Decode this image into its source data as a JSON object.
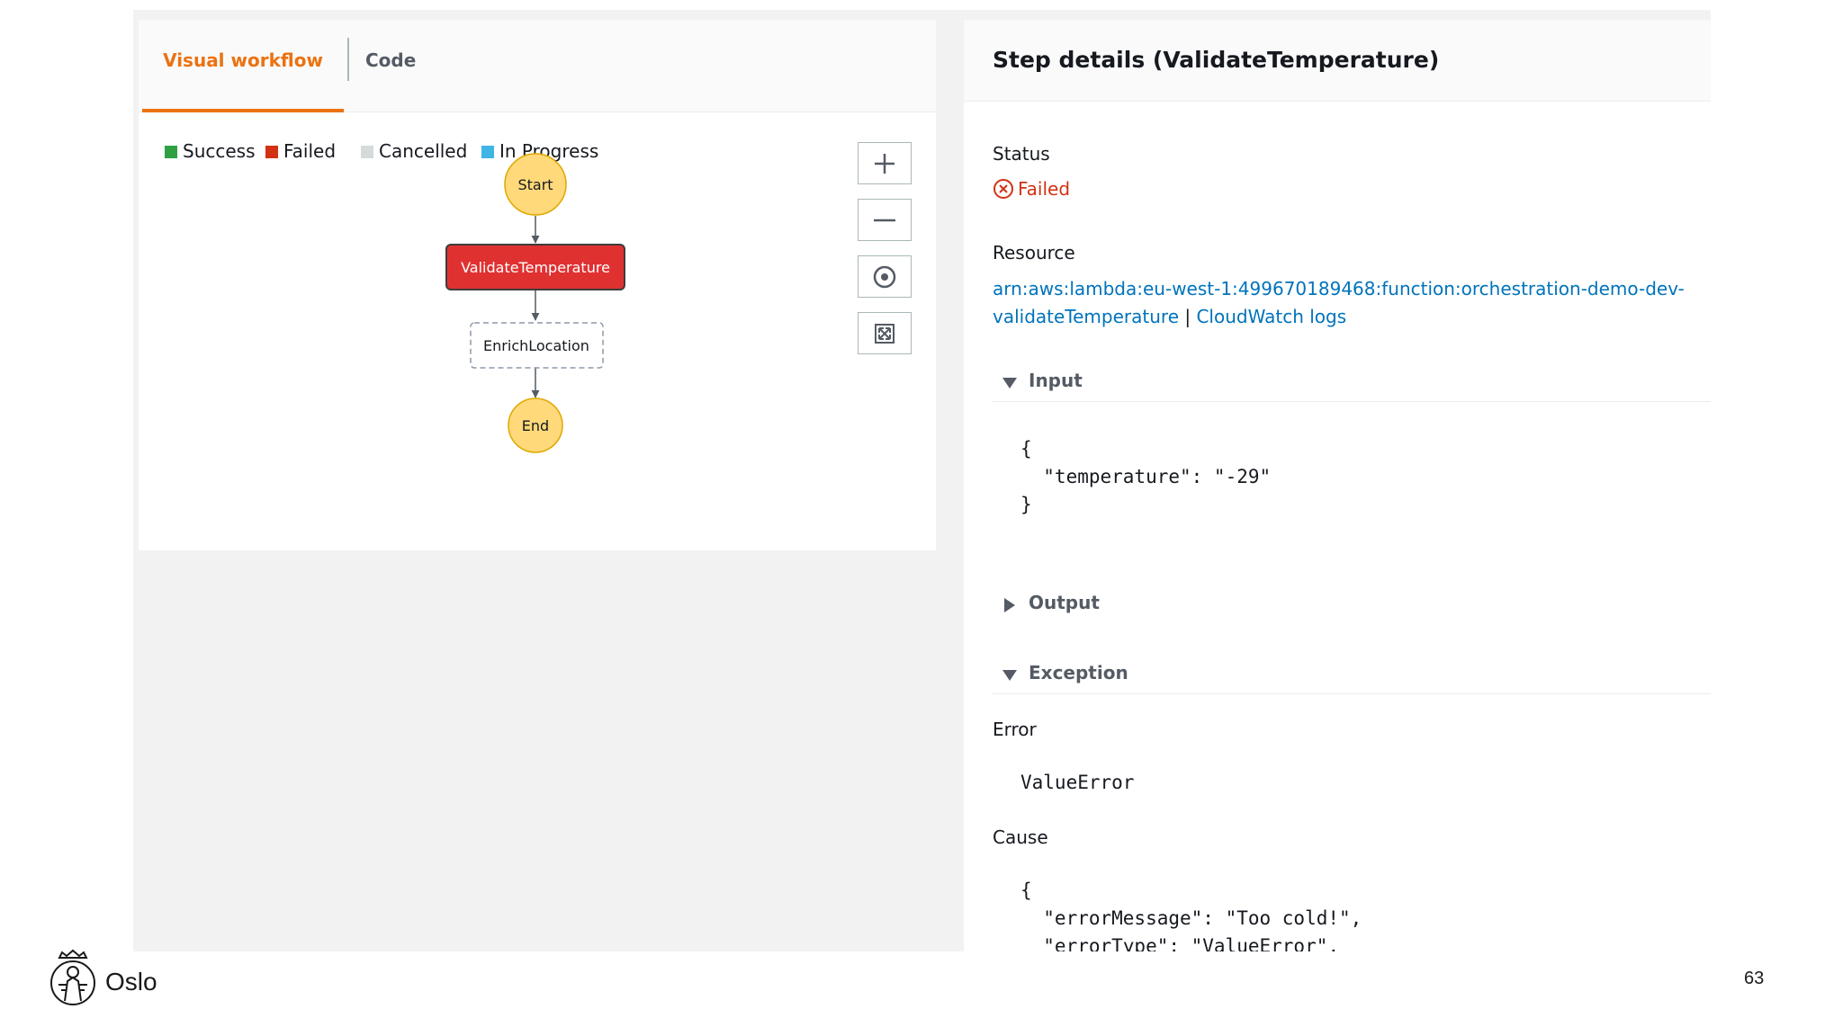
{
  "tabs": {
    "visual": "Visual workflow",
    "code": "Code"
  },
  "legend": [
    {
      "label": "Success",
      "color": "#2ea043"
    },
    {
      "label": "Failed",
      "color": "#d13212"
    },
    {
      "label": "Cancelled",
      "color": "#d5dbdb"
    },
    {
      "label": "In Progress",
      "color": "#3eb5e5"
    }
  ],
  "workflow": {
    "start": "Start",
    "validate": "ValidateTemperature",
    "enrich": "EnrichLocation",
    "end": "End",
    "colors": {
      "terminal": "#ffd97a",
      "failed": "#e03131"
    }
  },
  "zoom_controls": [
    "zoom-in-icon",
    "zoom-out-icon",
    "center-icon",
    "fit-icon"
  ],
  "step_details": {
    "title": "Step details (ValidateTemperature)",
    "status_label": "Status",
    "status_value": "Failed",
    "resource_label": "Resource",
    "resource_arn_line1": "arn:aws:lambda:eu-west-1:499670189468:function:orchestration-demo-dev-",
    "resource_arn_line2": "validateTemperature",
    "separator": "|",
    "cloudwatch_link": "CloudWatch logs",
    "input_title": "Input",
    "input_code": "{\n  \"temperature\": \"-29\"\n}",
    "output_title": "Output",
    "exception_title": "Exception",
    "error_label": "Error",
    "error_value": "ValueError",
    "cause_label": "Cause",
    "cause_code": "{\n  \"errorMessage\": \"Too cold!\",\n  \"errorType\": \"ValueError\","
  },
  "footer": {
    "brand": "Oslo",
    "page_number": "63"
  }
}
